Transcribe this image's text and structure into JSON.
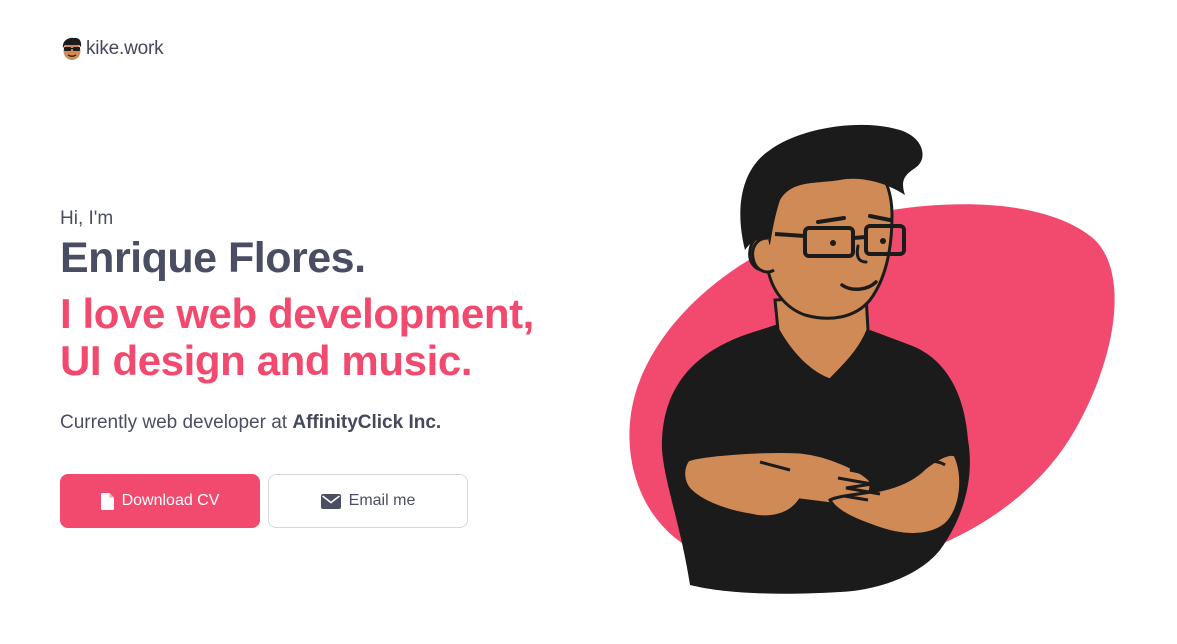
{
  "header": {
    "logo_text": "kike.work"
  },
  "hero": {
    "greeting": "Hi, I'm",
    "name": "Enrique Flores.",
    "tagline_line1": "I love web development,",
    "tagline_line2": "UI design and music.",
    "current_prefix": "Currently web developer at ",
    "current_company": "AffinityClick Inc."
  },
  "buttons": {
    "download_label": "Download CV",
    "download_icon": "file-icon",
    "email_label": "Email me",
    "email_icon": "envelope-icon"
  },
  "colors": {
    "accent": "#f2496e",
    "text": "#4b4e63",
    "illustration_skin": "#d08a55",
    "illustration_dark": "#1b1b1b"
  }
}
